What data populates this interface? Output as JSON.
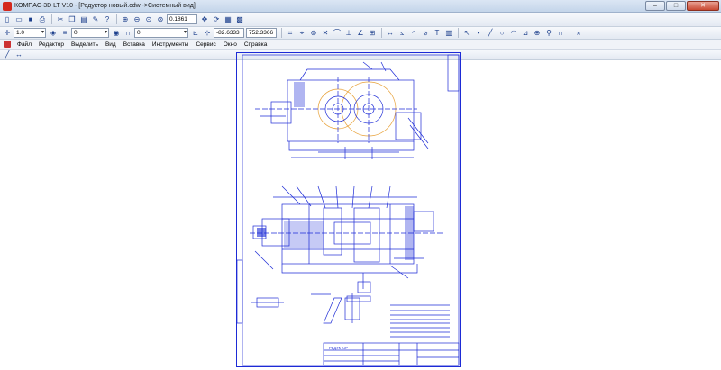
{
  "window": {
    "title": "КОМПАС-3D LT V10 - [Редуктор новый.cdw ->Системный вид]",
    "minimize_label": "–",
    "maximize_label": "□",
    "close_label": "✕"
  },
  "toolbar_top": {
    "zoom_value": "0.1861",
    "icons": [
      "new-icon",
      "open-icon",
      "save-icon",
      "print-icon",
      "cut-icon",
      "copy-icon",
      "paste-icon",
      "properties-icon",
      "help-icon",
      "zoom-in-icon",
      "zoom-out-icon",
      "zoom-window-icon",
      "zoom-all-icon",
      "pan-icon",
      "refresh-icon"
    ]
  },
  "toolbar_second": {
    "step_value": "1.0",
    "layer_value": "0",
    "style_value": "0",
    "coord_x": "-82.6333",
    "coord_y": "752.3366"
  },
  "menu": {
    "items": [
      "Файл",
      "Редактор",
      "Выделить",
      "Вид",
      "Вставка",
      "Инструменты",
      "Сервис",
      "Окно",
      "Справка"
    ]
  },
  "drawing": {
    "stamp_text": "РЕДУКТОР",
    "color": "#1d2bd6"
  }
}
